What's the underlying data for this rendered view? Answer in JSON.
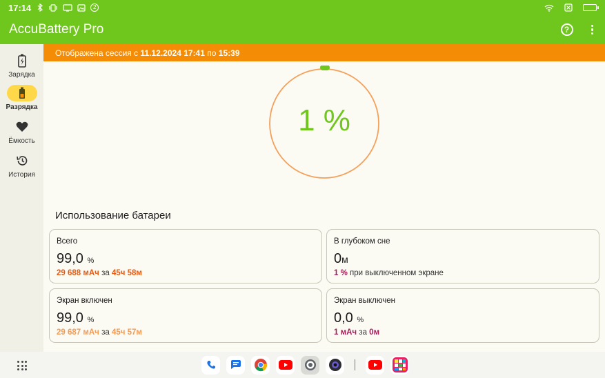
{
  "statusbar": {
    "time": "17:14",
    "notif_count": "2"
  },
  "app": {
    "title": "AccuBattery Pro"
  },
  "nav": {
    "items": [
      {
        "label": "Зарядка"
      },
      {
        "label": "Разрядка"
      },
      {
        "label": "Ёмкость"
      },
      {
        "label": "История"
      }
    ]
  },
  "banner": {
    "prefix": "Отображена сессия с",
    "start": "11.12.2024 17:41",
    "mid": "по",
    "end": "15:39"
  },
  "gauge": {
    "value": "1 %",
    "level_percent": 1
  },
  "section": {
    "title": "Использование батареи"
  },
  "cards": {
    "total": {
      "label": "Всего",
      "value": "99,0",
      "unit": "%",
      "mah": "29 688 мАч",
      "for": "за",
      "duration": "45ч 58м"
    },
    "deep_sleep": {
      "label": "В глубоком сне",
      "value": "0",
      "unit": "м",
      "pct": "1 %",
      "desc": "при выключенном экране"
    },
    "screen_on": {
      "label": "Экран включен",
      "value": "99,0",
      "unit": "%",
      "mah": "29 687 мАч",
      "for": "за",
      "duration": "45ч 57м"
    },
    "screen_off": {
      "label": "Экран выключен",
      "value": "0,0",
      "unit": "%",
      "mah": "1 мАч",
      "for": "за",
      "duration": "0м"
    }
  },
  "colors": {
    "accent_green": "#6fc61c",
    "banner_orange": "#f48c06",
    "gauge_ring": "#f5a05a",
    "active_nav": "#ffd84a"
  }
}
